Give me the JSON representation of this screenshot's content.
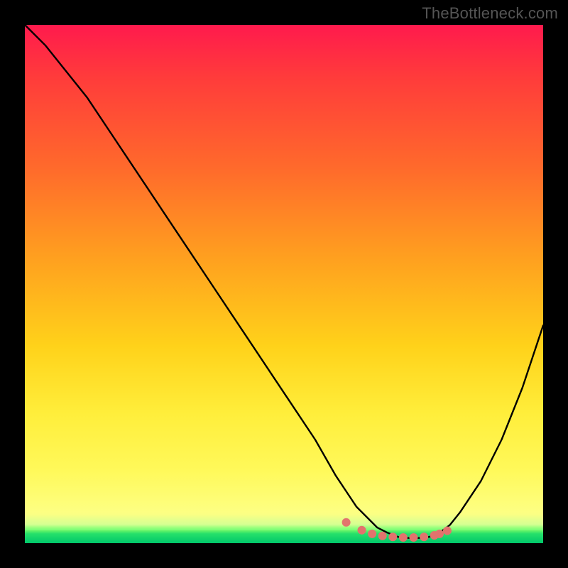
{
  "watermark": "TheBottleneck.com",
  "chart_data": {
    "type": "line",
    "title": "",
    "xlabel": "",
    "ylabel": "",
    "xlim": [
      0,
      100
    ],
    "ylim": [
      0,
      100
    ],
    "grid": false,
    "legend": false,
    "series": [
      {
        "name": "bottleneck-curve",
        "x": [
          0,
          4,
          8,
          12,
          16,
          20,
          24,
          28,
          32,
          36,
          40,
          44,
          48,
          52,
          56,
          60,
          62,
          64,
          66,
          68,
          70,
          72,
          74,
          76,
          78,
          80,
          82,
          84,
          88,
          92,
          96,
          100
        ],
        "values": [
          100,
          96,
          91,
          86,
          80,
          74,
          68,
          62,
          56,
          50,
          44,
          38,
          32,
          26,
          20,
          13,
          10,
          7,
          5,
          3,
          2,
          1.2,
          1,
          1,
          1.2,
          2,
          3.5,
          6,
          12,
          20,
          30,
          42
        ]
      }
    ],
    "markers": {
      "name": "valley-dots",
      "color": "#e2736d",
      "x": [
        62,
        65,
        67,
        69,
        71,
        73,
        75,
        77,
        79,
        80,
        81.5
      ],
      "values": [
        4,
        2.5,
        1.8,
        1.4,
        1.2,
        1.1,
        1.1,
        1.2,
        1.5,
        1.8,
        2.4
      ]
    },
    "colors": {
      "curve": "#000000",
      "gradient_top": "#ff1a4d",
      "gradient_mid": "#ffd21a",
      "gradient_bottom": "#00c76a",
      "marker": "#e2736d",
      "background": "#000000"
    }
  }
}
